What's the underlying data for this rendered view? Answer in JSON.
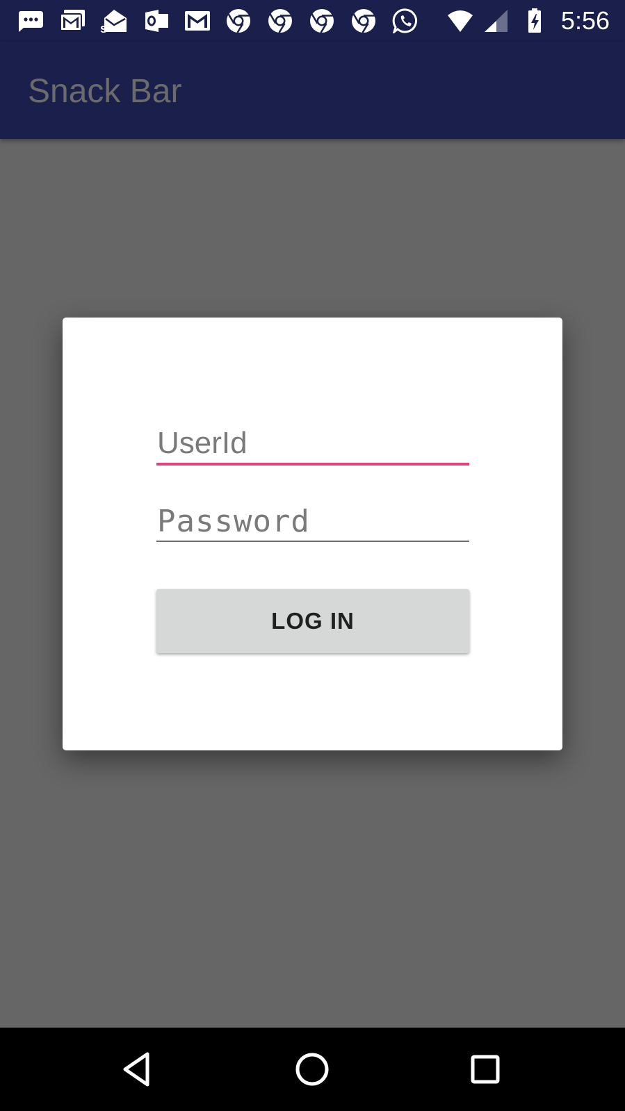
{
  "status_bar": {
    "time": "5:56",
    "icons": [
      "messages-icon",
      "gmail-icon",
      "mail-open-icon",
      "outlook-icon",
      "gmail-icon",
      "chrome-icon",
      "chrome-icon",
      "chrome-icon",
      "chrome-icon",
      "whatsapp-icon",
      "wifi-icon",
      "cell-signal-icon",
      "battery-charging-icon"
    ],
    "background_color": "#1a1f4b"
  },
  "app_bar": {
    "title": "Snack Bar",
    "background_color": "#1a1f4b"
  },
  "login_dialog": {
    "userid_placeholder": "UserId",
    "password_placeholder": "Password",
    "login_button_label": "LOG IN",
    "focused_field": "userid",
    "accent_color": "#e8417a"
  },
  "nav_bar": {
    "buttons": [
      "back-icon",
      "home-icon",
      "recents-icon"
    ]
  },
  "colors": {
    "scrim": "#666666",
    "button_background": "#d6d7d7"
  }
}
